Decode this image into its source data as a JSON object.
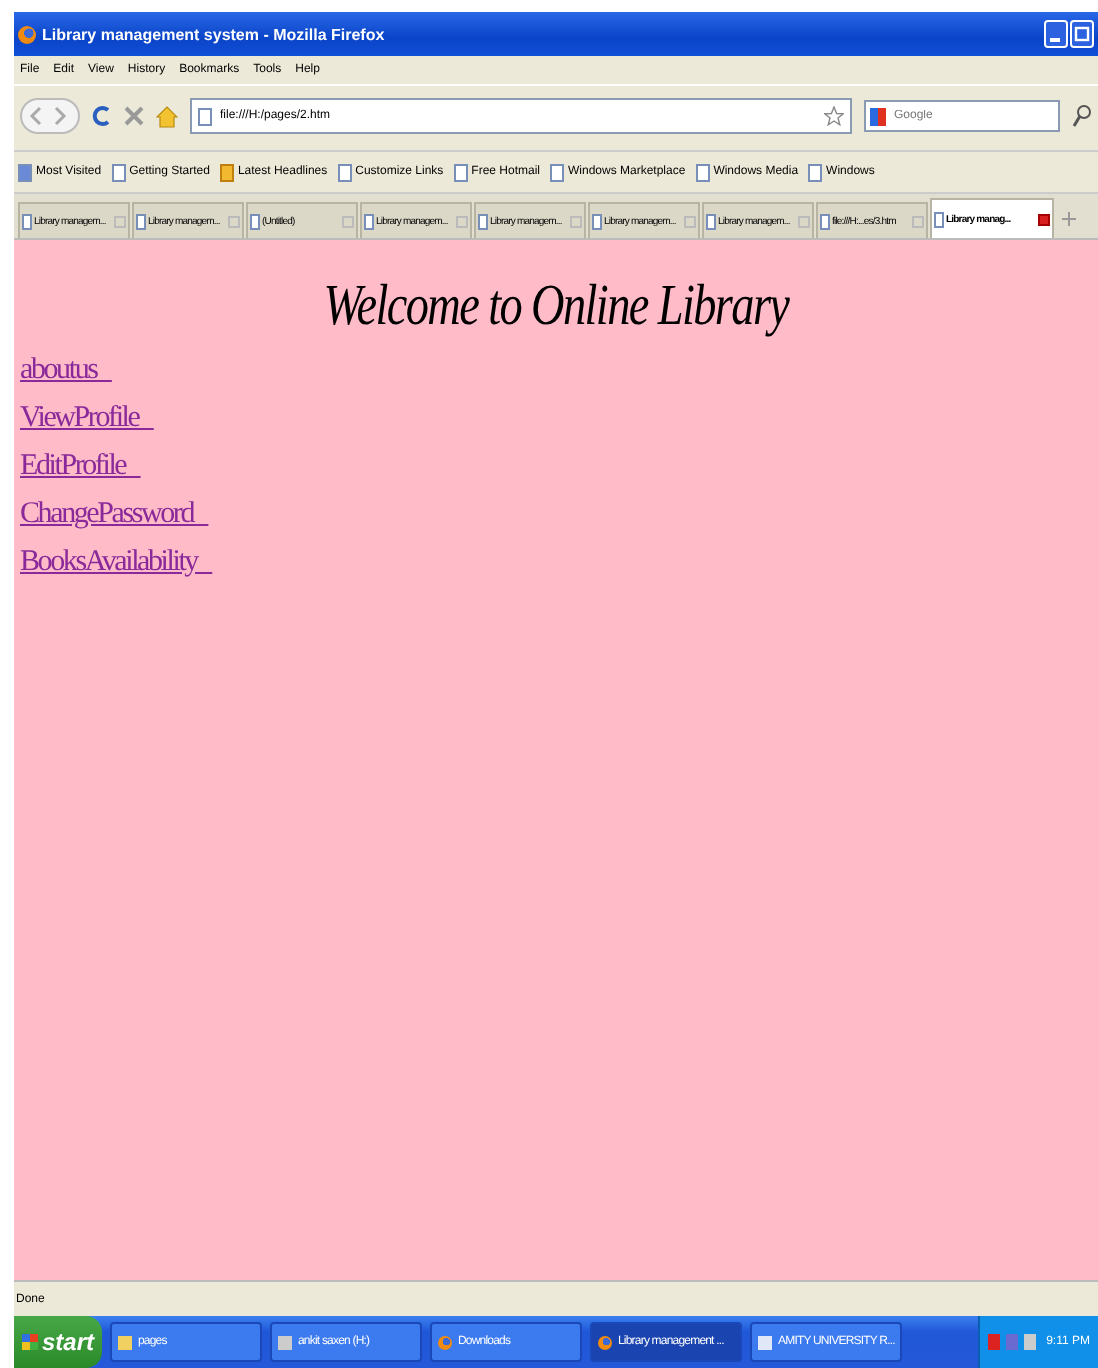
{
  "window": {
    "title": "Library management system - Mozilla Firefox"
  },
  "menu": [
    "File",
    "Edit",
    "View",
    "History",
    "Bookmarks",
    "Tools",
    "Help"
  ],
  "address": {
    "value": "file:///H:/pages/2.htm"
  },
  "search": {
    "placeholder": "Google"
  },
  "bookmarks": [
    {
      "label": "Most Visited",
      "kind": "folder"
    },
    {
      "label": "Getting Started",
      "kind": "page"
    },
    {
      "label": "Latest Headlines",
      "kind": "feed"
    },
    {
      "label": "Customize Links",
      "kind": "page"
    },
    {
      "label": "Free Hotmail",
      "kind": "page"
    },
    {
      "label": "Windows Marketplace",
      "kind": "page"
    },
    {
      "label": "Windows Media",
      "kind": "page"
    },
    {
      "label": "Windows",
      "kind": "page"
    }
  ],
  "tabs": [
    {
      "label": "Library managem...",
      "selected": false
    },
    {
      "label": "Library managem...",
      "selected": false
    },
    {
      "label": "(Untitled)",
      "selected": false
    },
    {
      "label": "Library managem...",
      "selected": false
    },
    {
      "label": "Library managem...",
      "selected": false
    },
    {
      "label": "Library managem...",
      "selected": false
    },
    {
      "label": "Library managem...",
      "selected": false
    },
    {
      "label": "file:///H:...es/3.htm",
      "selected": false
    },
    {
      "label": "Library manag...",
      "selected": true
    }
  ],
  "page": {
    "heading": "Welcome to Online Library",
    "links": [
      "aboutus",
      "ViewProfile",
      "EditProfile",
      "ChangePassword",
      "BooksAvailability"
    ]
  },
  "status_bar": "Done",
  "taskbar": {
    "start": "start",
    "items": [
      {
        "label": "pages",
        "kind": "folder",
        "selected": false
      },
      {
        "label": "ankit saxen (H:)",
        "kind": "drive",
        "selected": false
      },
      {
        "label": "Downloads",
        "kind": "firefox",
        "selected": false
      },
      {
        "label": "Library management ...",
        "kind": "firefox",
        "selected": true
      },
      {
        "label": "AMITY UNIVERSITY R...",
        "kind": "document",
        "selected": false
      }
    ],
    "clock": "9:11 PM"
  }
}
